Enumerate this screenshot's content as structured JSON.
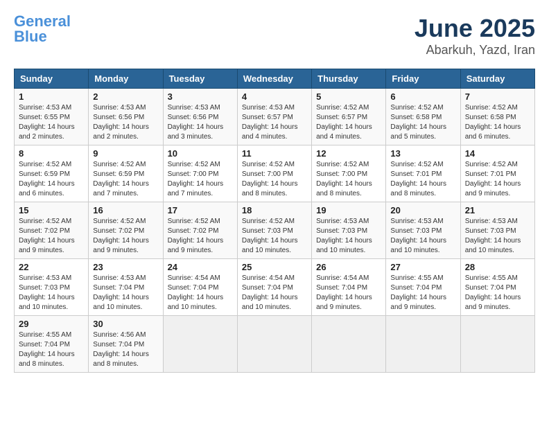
{
  "header": {
    "logo_general": "General",
    "logo_blue": "Blue",
    "title": "June 2025",
    "subtitle": "Abarkuh, Yazd, Iran"
  },
  "weekdays": [
    "Sunday",
    "Monday",
    "Tuesday",
    "Wednesday",
    "Thursday",
    "Friday",
    "Saturday"
  ],
  "weeks": [
    [
      {
        "day": "1",
        "sunrise": "4:53 AM",
        "sunset": "6:55 PM",
        "daylight": "14 hours and 2 minutes."
      },
      {
        "day": "2",
        "sunrise": "4:53 AM",
        "sunset": "6:56 PM",
        "daylight": "14 hours and 2 minutes."
      },
      {
        "day": "3",
        "sunrise": "4:53 AM",
        "sunset": "6:56 PM",
        "daylight": "14 hours and 3 minutes."
      },
      {
        "day": "4",
        "sunrise": "4:53 AM",
        "sunset": "6:57 PM",
        "daylight": "14 hours and 4 minutes."
      },
      {
        "day": "5",
        "sunrise": "4:52 AM",
        "sunset": "6:57 PM",
        "daylight": "14 hours and 4 minutes."
      },
      {
        "day": "6",
        "sunrise": "4:52 AM",
        "sunset": "6:58 PM",
        "daylight": "14 hours and 5 minutes."
      },
      {
        "day": "7",
        "sunrise": "4:52 AM",
        "sunset": "6:58 PM",
        "daylight": "14 hours and 6 minutes."
      }
    ],
    [
      {
        "day": "8",
        "sunrise": "4:52 AM",
        "sunset": "6:59 PM",
        "daylight": "14 hours and 6 minutes."
      },
      {
        "day": "9",
        "sunrise": "4:52 AM",
        "sunset": "6:59 PM",
        "daylight": "14 hours and 7 minutes."
      },
      {
        "day": "10",
        "sunrise": "4:52 AM",
        "sunset": "7:00 PM",
        "daylight": "14 hours and 7 minutes."
      },
      {
        "day": "11",
        "sunrise": "4:52 AM",
        "sunset": "7:00 PM",
        "daylight": "14 hours and 8 minutes."
      },
      {
        "day": "12",
        "sunrise": "4:52 AM",
        "sunset": "7:00 PM",
        "daylight": "14 hours and 8 minutes."
      },
      {
        "day": "13",
        "sunrise": "4:52 AM",
        "sunset": "7:01 PM",
        "daylight": "14 hours and 8 minutes."
      },
      {
        "day": "14",
        "sunrise": "4:52 AM",
        "sunset": "7:01 PM",
        "daylight": "14 hours and 9 minutes."
      }
    ],
    [
      {
        "day": "15",
        "sunrise": "4:52 AM",
        "sunset": "7:02 PM",
        "daylight": "14 hours and 9 minutes."
      },
      {
        "day": "16",
        "sunrise": "4:52 AM",
        "sunset": "7:02 PM",
        "daylight": "14 hours and 9 minutes."
      },
      {
        "day": "17",
        "sunrise": "4:52 AM",
        "sunset": "7:02 PM",
        "daylight": "14 hours and 9 minutes."
      },
      {
        "day": "18",
        "sunrise": "4:52 AM",
        "sunset": "7:03 PM",
        "daylight": "14 hours and 10 minutes."
      },
      {
        "day": "19",
        "sunrise": "4:53 AM",
        "sunset": "7:03 PM",
        "daylight": "14 hours and 10 minutes."
      },
      {
        "day": "20",
        "sunrise": "4:53 AM",
        "sunset": "7:03 PM",
        "daylight": "14 hours and 10 minutes."
      },
      {
        "day": "21",
        "sunrise": "4:53 AM",
        "sunset": "7:03 PM",
        "daylight": "14 hours and 10 minutes."
      }
    ],
    [
      {
        "day": "22",
        "sunrise": "4:53 AM",
        "sunset": "7:03 PM",
        "daylight": "14 hours and 10 minutes."
      },
      {
        "day": "23",
        "sunrise": "4:53 AM",
        "sunset": "7:04 PM",
        "daylight": "14 hours and 10 minutes."
      },
      {
        "day": "24",
        "sunrise": "4:54 AM",
        "sunset": "7:04 PM",
        "daylight": "14 hours and 10 minutes."
      },
      {
        "day": "25",
        "sunrise": "4:54 AM",
        "sunset": "7:04 PM",
        "daylight": "14 hours and 10 minutes."
      },
      {
        "day": "26",
        "sunrise": "4:54 AM",
        "sunset": "7:04 PM",
        "daylight": "14 hours and 9 minutes."
      },
      {
        "day": "27",
        "sunrise": "4:55 AM",
        "sunset": "7:04 PM",
        "daylight": "14 hours and 9 minutes."
      },
      {
        "day": "28",
        "sunrise": "4:55 AM",
        "sunset": "7:04 PM",
        "daylight": "14 hours and 9 minutes."
      }
    ],
    [
      {
        "day": "29",
        "sunrise": "4:55 AM",
        "sunset": "7:04 PM",
        "daylight": "14 hours and 8 minutes."
      },
      {
        "day": "30",
        "sunrise": "4:56 AM",
        "sunset": "7:04 PM",
        "daylight": "14 hours and 8 minutes."
      },
      null,
      null,
      null,
      null,
      null
    ]
  ]
}
